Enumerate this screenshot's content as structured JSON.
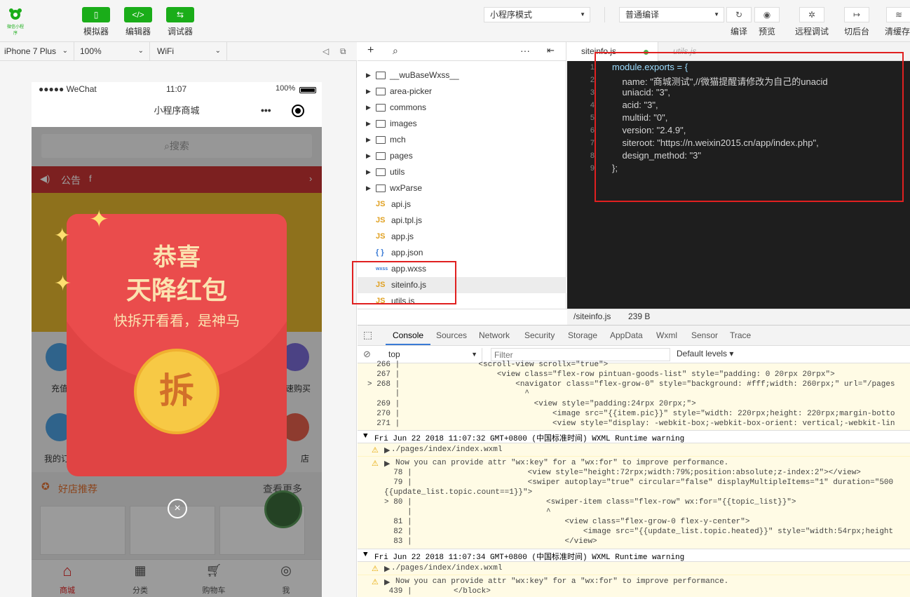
{
  "toolbar": {
    "logo_text": "微信小程序",
    "simulator": "模拟器",
    "editor": "编辑器",
    "debugger": "调试器",
    "mode_select": "小程序模式",
    "compile_select": "普通编译",
    "compile": "编译",
    "preview": "预览",
    "remote_debug": "远程调试",
    "background": "切后台",
    "clear_cache": "清缓存"
  },
  "device_bar": {
    "device": "iPhone 7 Plus",
    "zoom": "100%",
    "network": "WiFi"
  },
  "phone": {
    "carrier": "●●●●● WeChat",
    "time": "11:07",
    "battery": "100%",
    "title": "小程序商城",
    "search_placeholder": "搜索",
    "notice_label": "公告",
    "notice_text": "f",
    "redpacket_line1": "恭喜",
    "redpacket_line2": "天降红包",
    "redpacket_line3": "快拆开看看，是神马",
    "open_button": "拆",
    "recommend": "好店推荐",
    "see_more": "查看更多",
    "cat_left1": "充值",
    "cat_right1": "速购买",
    "cat_left2": "我的订",
    "cat_right2": "店",
    "tab_home": "商城",
    "tab_category": "分类",
    "tab_cart": "购物车",
    "tab_me": "我"
  },
  "filetree": {
    "folders": [
      "__wuBaseWxss__",
      "area-picker",
      "commons",
      "images",
      "mch",
      "pages",
      "utils",
      "wxParse"
    ],
    "files": [
      {
        "icon": "JS",
        "name": "api.js"
      },
      {
        "icon": "JS",
        "name": "api.tpl.js"
      },
      {
        "icon": "JS",
        "name": "app.js"
      },
      {
        "icon": "{ }",
        "name": "app.json"
      },
      {
        "icon": "wxss",
        "name": "app.wxss"
      },
      {
        "icon": "JS",
        "name": "siteinfo.js"
      },
      {
        "icon": "JS",
        "name": "utils.js"
      }
    ]
  },
  "editor": {
    "tab_active": "siteinfo.js",
    "tab_inactive": "utils.js",
    "lines": [
      "module.exports = {",
      "    name: \"商城测试\",//微猫提醒请修改为自己的unacid",
      "    uniacid: \"3\",",
      "    acid: \"3\",",
      "    multiid: \"0\",",
      "    version: \"2.4.9\",",
      "    siteroot: \"https://n.weixin2015.cn/app/index.php\",",
      "    design_method: \"3\"",
      "};"
    ],
    "status_path": "/siteinfo.js",
    "status_size": "239 B"
  },
  "devtools": {
    "tabs": [
      "Console",
      "Sources",
      "Network",
      "Security",
      "Storage",
      "AppData",
      "Wxml",
      "Sensor",
      "Trace"
    ],
    "context": "top",
    "filter_placeholder": "Filter",
    "levels": "Default levels"
  },
  "console_log": {
    "l266": "  266 |                 <scroll-view scrollx=\"true\">",
    "l267": "  267 |                     <view class=\"flex-row pintuan-goods-list\" style=\"padding: 0 20rpx 20rpx\">",
    "l268": "> 268 |                         <navigator class=\"flex-grow-0\" style=\"background: #fff;width: 260rpx;\" url=\"/pages",
    "l268c": "      |                           ^",
    "l269": "  269 |                             <view style=\"padding:24rpx 20rpx;\">",
    "l270": "  270 |                                 <image src=\"{{item.pic}}\" style=\"width: 220rpx;height: 220rpx;margin-botto",
    "l271": "  271 |                                 <view style=\"display: -webkit-box;-webkit-box-orient: vertical;-webkit-lin",
    "hdr1": "Fri Jun 22 2018 11:07:32 GMT+0800 (中国标准时间) WXML Runtime warning",
    "path1": "./pages/index/index.wxml",
    "warn1": "Now you can provide attr \"wx:key\" for a \"wx:for\" to improve performance.",
    "l78": "  78 |                         <view style=\"height:72rpx;width:79%;position:absolute;z-index:2\"></view>",
    "l79": "  79 |                         <swiper autoplay=\"true\" circular=\"false\" displayMultipleItems=\"1\" duration=\"500",
    "l79b": "{{update_list.topic.count==1}}\">",
    "l80": "> 80 |                             <swiper-item class=\"flex-row\" wx:for=\"{{topic_list}}\">",
    "l80c": "     |                             ^",
    "l81": "  81 |                                 <view class=\"flex-grow-0 flex-y-center\">",
    "l82": "  82 |                                     <image src=\"{{update_list.topic.heated}}\" style=\"width:54rpx;height",
    "l83": "  83 |                                 </view>",
    "hdr2": "Fri Jun 22 2018 11:07:34 GMT+0800 (中国标准时间) WXML Runtime warning",
    "path2": "./pages/index/index.wxml",
    "warn2": "Now you can provide attr \"wx:key\" for a \"wx:for\" to improve performance.",
    "l439": " 439 |         </block>"
  },
  "colors": {
    "wechat_green": "#1aad19",
    "highlight_red": "#e02020",
    "redpacket": "#e84040",
    "coin": "#f7c945"
  }
}
